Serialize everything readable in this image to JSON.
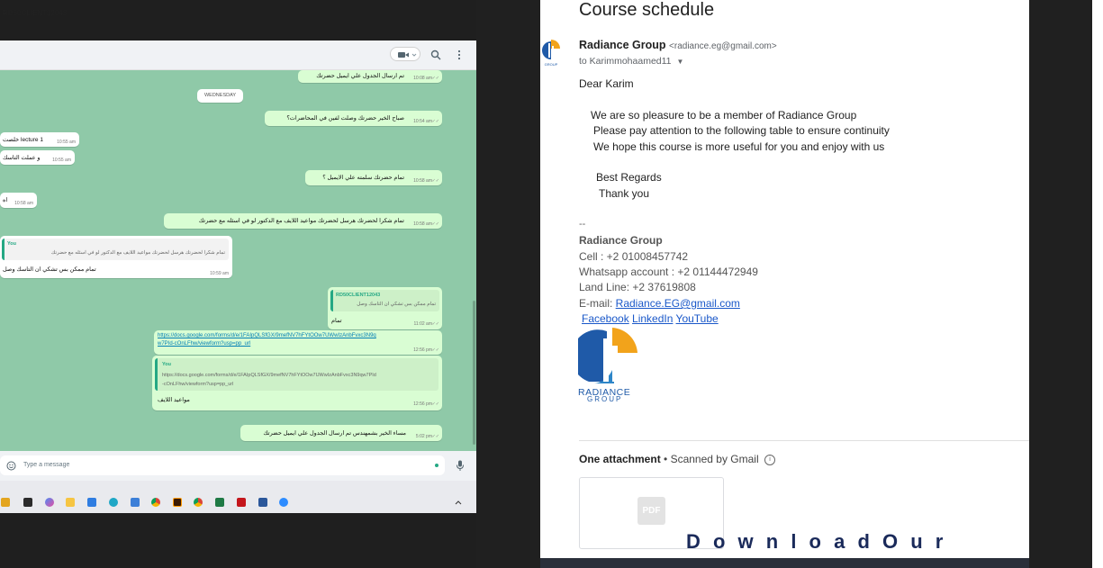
{
  "chat": {
    "contact_name": "RD50CLIENT12043",
    "date_divider": "WEDNESDAY",
    "messages": [
      {
        "text": "تم ارسال الجدول علي  ايميل  حضرتك",
        "time": "10:08 am"
      },
      {
        "text": "صباح الخير حضرتك وصلت لفين في المحاضرات؟",
        "time": "10:54 am"
      },
      {
        "text": "خلصت lecture 1",
        "time": "10:55 am"
      },
      {
        "text": "و عملت التاسك",
        "time": "10:55 am"
      },
      {
        "text": "تمام حضرتك سلمته علي الايميل ؟",
        "time": "10:58 am"
      },
      {
        "text": "اه",
        "time": "10:58 am"
      },
      {
        "text": "تمام شكرا لحضرتك هرسل لحضرتك مواعيد اللايف مع الدكتور لو في اسئله مع حضرتك",
        "time": "10:58 am"
      },
      {
        "quote_name": "You",
        "quote_text": "تمام شكرا لحضرتك هرسل لحضرتك مواعيد اللايف مع الدكتور لو في اسئله مع حضرتك",
        "text": "تمام ممكن بس تشكي ان التاسك وصل",
        "time": "10:59 am"
      },
      {
        "quote_name": "RD50CLIENT12043",
        "quote_text": "تمام ممكن بس تشكي ان التاسك وصل",
        "text": "تمام",
        "time": "11:02 am"
      },
      {
        "link_line1": "https://docs.google.com/forms/d/e/1FAIpQLSfGX/9mefNV7hFYtOOw7UWwIzAnbFvxc3N9q",
        "link_line2": "w7PId-cOnLFhw/viewform?usp=pp_url",
        "time": "12:56 pm"
      },
      {
        "quote_name": "You",
        "quote_line1": "https://docs.google.com/forms/d/e/1FAIpQLSfGX/9mefNV7hFYtOOw7UWwIzAnbFvxc3N9qw7PId",
        "quote_line2": "-cOnLFhw/viewform?usp=pp_url",
        "text": "مواعيد اللايف",
        "time": "12:56 pm"
      },
      {
        "text": "مساء الخير بشمهندس تم ارسال الجدول علي ايميل حضرتك",
        "time": "5:02 pm"
      }
    ],
    "input_placeholder": "Type a message"
  },
  "email": {
    "subject": "Course schedule",
    "sender_name": "Radiance Group",
    "sender_email": "<radiance.eg@gmail.com>",
    "to_line": "to Karimmohaamed11",
    "greeting": "Dear Karim",
    "body_lines": [
      "We are so pleasure to be a member of Radiance Group",
      "Please pay attention to the following table to ensure continuity",
      "We hope this course is more useful for you and enjoy with us"
    ],
    "regards": "Best Regards",
    "thanks": "Thank you",
    "sig_separator": "--",
    "sig_name": "Radiance Group",
    "cell": "Cell : +2 01008457742",
    "whatsapp": "Whatsapp account : +2 01144472949",
    "landline": "Land Line: +2 37619808",
    "email_label": "E-mail: ",
    "email_link": "Radiance.EG@gmail.com",
    "social": [
      "Facebook",
      "LinkedIn",
      "YouTube "
    ],
    "logo_text_1": "RADIANCE",
    "logo_text_2": "GROUP",
    "attachment_title": "One attachment",
    "scanned_text": " • Scanned by Gmail",
    "pdf_label": "PDF",
    "download_text": "D o w n l o a d   O u r"
  },
  "colors": {
    "chat_bg": "#8fc9a8",
    "outgoing_bubble": "#d9fdd3",
    "link": "#1a58c9",
    "logo_orange": "#f2a31b",
    "logo_blue": "#1f5aa8"
  }
}
